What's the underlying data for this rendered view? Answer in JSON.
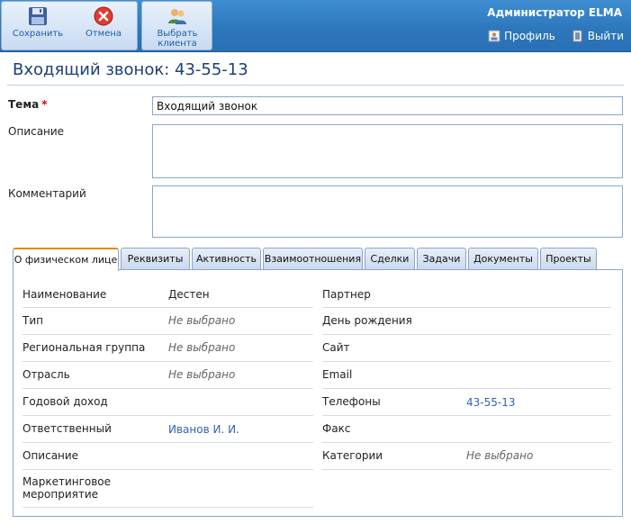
{
  "toolbar": {
    "save_label": "Сохранить",
    "cancel_label": "Отмена",
    "select_client_label_1": "Выбрать",
    "select_client_label_2": "клиента"
  },
  "header": {
    "user": "Администратор ELMA",
    "profile_label": "Профиль",
    "logout_label": "Выйти"
  },
  "page": {
    "title": "Входящий звонок: 43-55-13"
  },
  "form": {
    "subject_label": "Тема",
    "subject_required": "*",
    "subject_value": "Входящий звонок",
    "description_label": "Описание",
    "description_value": "",
    "comment_label": "Комментарий",
    "comment_value": ""
  },
  "tabs": [
    {
      "label": "О физическом лице"
    },
    {
      "label": "Реквизиты"
    },
    {
      "label": "Активность"
    },
    {
      "label": "Взаимоотношения"
    },
    {
      "label": "Сделки"
    },
    {
      "label": "Задачи"
    },
    {
      "label": "Документы"
    },
    {
      "label": "Проекты"
    }
  ],
  "left_fields": [
    {
      "label": "Наименование",
      "value": "Дестен"
    },
    {
      "label": "Тип",
      "value": "Не выбрано"
    },
    {
      "label": "Региональная группа",
      "value": "Не выбрано"
    },
    {
      "label": "Отрасль",
      "value": "Не выбрано"
    },
    {
      "label": "Годовой доход",
      "value": ""
    },
    {
      "label": "Ответственный",
      "value": "Иванов И. И."
    },
    {
      "label": "Описание",
      "value": ""
    },
    {
      "label": "Маркетинговое",
      "label2": "мероприятие",
      "value": ""
    }
  ],
  "right_fields": [
    {
      "label": "Партнер",
      "value": ""
    },
    {
      "label": "День рождения",
      "value": ""
    },
    {
      "label": "Сайт",
      "value": ""
    },
    {
      "label": "Email",
      "value": ""
    },
    {
      "label": "Телефоны",
      "value": "43-55-13"
    },
    {
      "label": "Факс",
      "value": ""
    },
    {
      "label": "Категории",
      "value": "Не выбрано"
    }
  ],
  "colors": {
    "toolbar_blue": "#2e77bd",
    "title_color": "#1c3f7a",
    "link_color": "#2e64b4",
    "required_red": "#dd0000",
    "active_tab_accent": "#e08a1e"
  },
  "icons": {
    "save": "floppy-disk-icon",
    "cancel": "cancel-x-icon",
    "select_client": "users-icon",
    "profile": "profile-icon",
    "logout": "logout-icon"
  }
}
